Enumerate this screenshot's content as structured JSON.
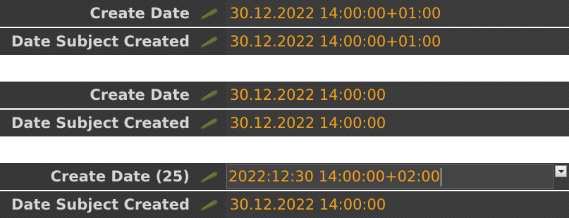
{
  "group1": {
    "rows": [
      {
        "label": "Create Date",
        "value": "30.12.2022 14:00:00+01:00"
      },
      {
        "label": "Date Subject Created",
        "value": "30.12.2022 14:00:00+01:00"
      }
    ]
  },
  "group2": {
    "rows": [
      {
        "label": "Create Date",
        "value": "30.12.2022 14:00:00"
      },
      {
        "label": "Date Subject Created",
        "value": "30.12.2022 14:00:00"
      }
    ]
  },
  "group3": {
    "rows": [
      {
        "label": "Create Date (25)",
        "value": "2022:12:30 14:00:00+02:00",
        "editing": true
      },
      {
        "label": "Date Subject Created",
        "value": "30.12.2022 14:00:00"
      }
    ]
  },
  "icons": {
    "edit": "pencil-icon",
    "dropdown": "chevron-down-icon"
  },
  "colors": {
    "label_text": "#d6d6d6",
    "value_text": "#f0a020",
    "row_background": "#3a3a3a"
  }
}
